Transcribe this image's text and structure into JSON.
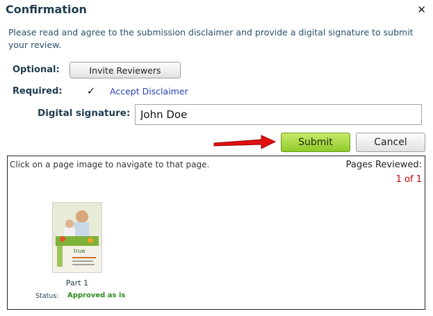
{
  "dialog": {
    "title": "Confirmation",
    "close_icon": "close-icon",
    "instructions": "Please read and agree to the submission disclaimer and provide a digital signature to submit your review."
  },
  "optional": {
    "label": "Optional:",
    "invite_button": "Invite Reviewers"
  },
  "required": {
    "label": "Required:",
    "checkbox_checked": true,
    "accept_link": "Accept Disclaimer"
  },
  "signature": {
    "label": "Digital signature:",
    "value": "John Doe"
  },
  "actions": {
    "submit": "Submit",
    "cancel": "Cancel",
    "pointer_icon": "red-arrow-icon"
  },
  "pages": {
    "hint": "Click on a page image to navigate to that page.",
    "reviewed_label": "Pages Reviewed:",
    "reviewed_count": "1 of 1",
    "items": [
      {
        "label": "Part 1",
        "status_label": "Status:",
        "status_value": "Approved as is",
        "thumb_text": "true"
      }
    ]
  },
  "colors": {
    "title": "#1e3c50",
    "link": "#2a3fb0",
    "submit_green": "#8fca2a",
    "count_red": "#c00000",
    "status_green": "#2a8a1a"
  }
}
